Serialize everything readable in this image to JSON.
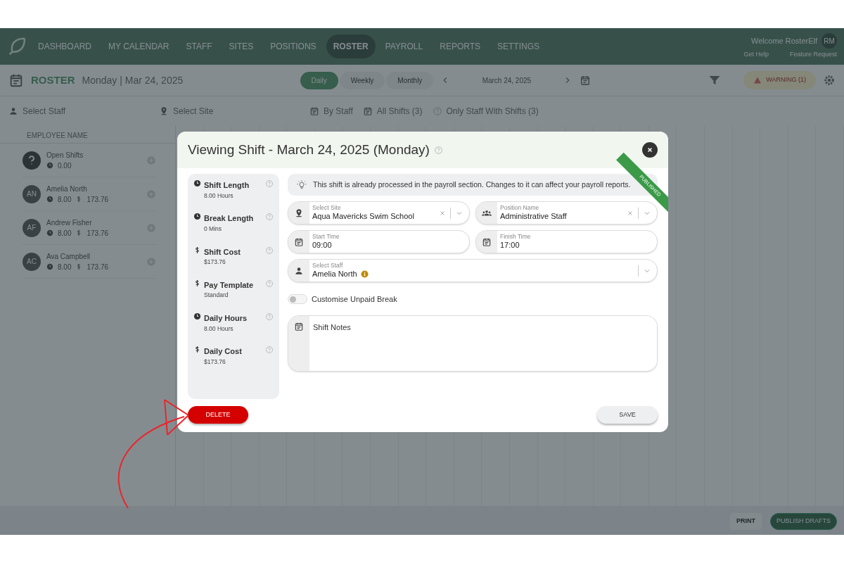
{
  "nav": {
    "items": [
      {
        "label": "DASHBOARD",
        "selected": false
      },
      {
        "label": "MY CALENDAR",
        "selected": false
      },
      {
        "label": "STAFF",
        "selected": false
      },
      {
        "label": "SITES",
        "selected": false
      },
      {
        "label": "POSITIONS",
        "selected": false
      },
      {
        "label": "ROSTER",
        "selected": true
      },
      {
        "label": "PAYROLL",
        "selected": false
      },
      {
        "label": "REPORTS",
        "selected": false
      },
      {
        "label": "SETTINGS",
        "selected": false
      }
    ],
    "welcome": "Welcome RosterElf",
    "avatar": "RM",
    "help": "Get Help",
    "feature": "Feature Request"
  },
  "toolbar": {
    "title": "ROSTER",
    "date": "Monday | Mar 24, 2025",
    "views": [
      {
        "label": "Daily",
        "selected": true
      },
      {
        "label": "Weekly",
        "selected": false
      },
      {
        "label": "Monthly",
        "selected": false
      }
    ],
    "current_date": "March 24, 2025",
    "warning": "WARNING (1)"
  },
  "filters": {
    "staff_placeholder": "Select Staff",
    "site_placeholder": "Select Site",
    "group": "By Staff",
    "shifts": "All Shifts (3)",
    "visibility": "Only Staff With Shifts (3)"
  },
  "table": {
    "header": "EMPLOYEE NAME",
    "rows": [
      {
        "kind": "open",
        "name": "Open Shifts",
        "hours": "0.00"
      },
      {
        "kind": "staff",
        "initials": "AN",
        "name": "Amelia North",
        "hours": "8.00",
        "cost": "173.76"
      },
      {
        "kind": "staff",
        "initials": "AF",
        "name": "Andrew Fisher",
        "hours": "8.00",
        "cost": "173.76"
      },
      {
        "kind": "staff",
        "initials": "AC",
        "name": "Ava Campbell",
        "hours": "8.00",
        "cost": "173.76"
      }
    ]
  },
  "modal": {
    "title": "Viewing Shift - March 24, 2025 (Monday)",
    "ribbon": "PUBLISHED",
    "stats": [
      {
        "kind": "clock",
        "label": "Shift Length",
        "value": "8.00 Hours"
      },
      {
        "kind": "clock",
        "label": "Break Length",
        "value": "0 Mins"
      },
      {
        "kind": "dollar",
        "label": "Shift Cost",
        "value": "$173.76"
      },
      {
        "kind": "dollar",
        "label": "Pay Template",
        "value": "Standard"
      },
      {
        "kind": "clock",
        "label": "Daily Hours",
        "value": "8.00 Hours"
      },
      {
        "kind": "dollar",
        "label": "Daily Cost",
        "value": "$173.76"
      }
    ],
    "notice": "This shift is already processed in the payroll section. Changes to it can affect your payroll reports.",
    "site": {
      "label": "Select Site",
      "value": "Aqua Mavericks Swim School"
    },
    "position": {
      "label": "Position Name",
      "value": "Administrative Staff"
    },
    "start_time": {
      "label": "Start Time",
      "value": "09:00"
    },
    "finish_time": {
      "label": "Finish Time",
      "value": "17:00"
    },
    "staff": {
      "label": "Select Staff",
      "value": "Amelia North",
      "info": true
    },
    "unpaid_break": {
      "label": "Customise Unpaid Break",
      "on": false
    },
    "notes": {
      "placeholder": "Shift Notes"
    },
    "delete": "DELETE",
    "save": "SAVE"
  },
  "footer": {
    "print": "PRINT",
    "publish": "PUBLISH DRAFTS"
  }
}
